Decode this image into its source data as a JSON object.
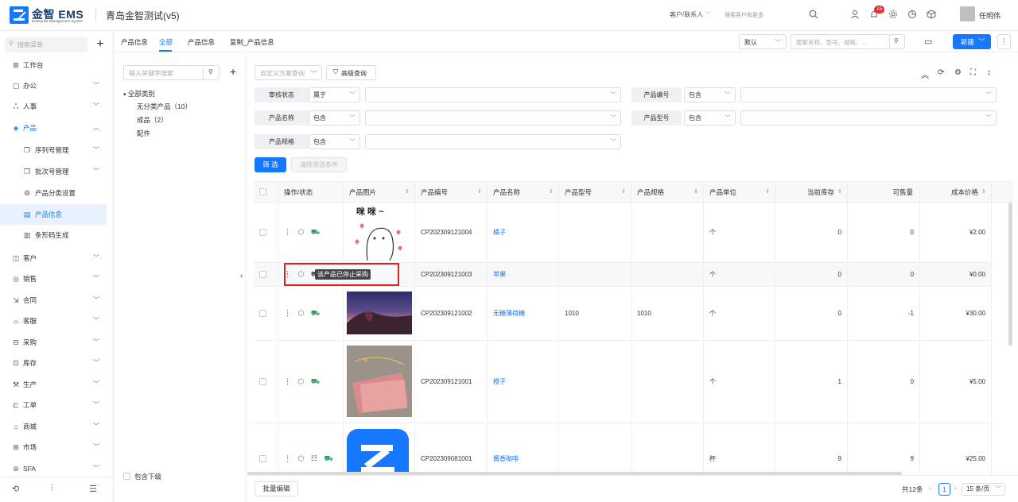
{
  "header": {
    "logo_text": "金智 EMS",
    "logo_sub": "Enterprise Management System",
    "company": "青岛金智测试(v5)",
    "search_type": "客户/联系人",
    "search_placeholder": "搜索客户和更多",
    "notification_count": "15",
    "user_name": "任明伟"
  },
  "sidebar": {
    "search_placeholder": "搜索菜单",
    "items": [
      {
        "label": "工作台",
        "icon": "dashboard-icon"
      },
      {
        "label": "办公",
        "icon": "office-icon"
      },
      {
        "label": "人事",
        "icon": "people-icon"
      },
      {
        "label": "产品",
        "icon": "product-icon"
      },
      {
        "label": "序列号管理",
        "icon": "serial-icon"
      },
      {
        "label": "批次号管理",
        "icon": "batch-icon"
      },
      {
        "label": "产品分类设置",
        "icon": "category-gear-icon"
      },
      {
        "label": "产品信息",
        "icon": "doc-icon"
      },
      {
        "label": "条形码生成",
        "icon": "barcode-icon"
      },
      {
        "label": "客户",
        "icon": "customer-icon"
      },
      {
        "label": "销售",
        "icon": "sales-icon"
      },
      {
        "label": "合同",
        "icon": "contract-icon"
      },
      {
        "label": "客服",
        "icon": "support-icon"
      },
      {
        "label": "采购",
        "icon": "purchase-icon"
      },
      {
        "label": "库存",
        "icon": "stock-icon"
      },
      {
        "label": "生产",
        "icon": "production-icon"
      },
      {
        "label": "工单",
        "icon": "workorder-icon"
      },
      {
        "label": "商城",
        "icon": "mall-icon"
      },
      {
        "label": "市场",
        "icon": "market-icon"
      },
      {
        "label": "SFA",
        "icon": "sfa-icon"
      }
    ]
  },
  "tabs": {
    "section_title": "产品信息",
    "items": [
      "全部",
      "产品信息",
      "复制_产品信息"
    ]
  },
  "toolbar": {
    "view_select": "默认",
    "search_placeholder": "搜索名称、型号、规格、...",
    "new_button": "新建"
  },
  "tree": {
    "search_placeholder": "输入关键字搜索",
    "root": "全部类别",
    "children": [
      "无分类产品（10）",
      "成品（2）",
      "配件"
    ],
    "include_sub": "包含下级"
  },
  "filters": {
    "custom_scheme_placeholder": "自定义方案查询",
    "advanced": "高级查询",
    "rows": [
      {
        "label": "审核状态",
        "op": "属于"
      },
      {
        "label": "产品编号",
        "op": "包含"
      },
      {
        "label": "产品名称",
        "op": "包含"
      },
      {
        "label": "产品型号",
        "op": "包含"
      },
      {
        "label": "产品规格",
        "op": "包含"
      }
    ],
    "filter_button": "筛 选",
    "clear_button": "清除筛选条件"
  },
  "table": {
    "columns": [
      "操作/状态",
      "产品图片",
      "产品编号",
      "产品名称",
      "产品型号",
      "产品规格",
      "产品单位",
      "当前库存",
      "可售量",
      "成本价格"
    ],
    "rows": [
      {
        "code": "CP202309121004",
        "name": "橘子",
        "model": "",
        "spec": "",
        "unit": "个",
        "stock": "0",
        "sellable": "0",
        "cost": "¥2.00"
      },
      {
        "code": "CP202309121003",
        "name": "苹果",
        "model": "",
        "spec": "",
        "unit": "个",
        "stock": "0",
        "sellable": "0",
        "cost": "¥0.00"
      },
      {
        "code": "CP202309121002",
        "name": "无糖薄荷糖",
        "model": "1010",
        "spec": "1010",
        "unit": "个",
        "stock": "0",
        "sellable": "-1",
        "cost": "¥30.00"
      },
      {
        "code": "CP202309121001",
        "name": "橙子",
        "model": "",
        "spec": "",
        "unit": "个",
        "stock": "1",
        "sellable": "0",
        "cost": "¥5.00"
      },
      {
        "code": "CP202309081001",
        "name": "酱香咖啡",
        "model": "",
        "spec": "",
        "unit": "杯",
        "stock": "9",
        "sellable": "9",
        "cost": "¥25.00"
      }
    ],
    "sticker_text": "咪 咪 ~",
    "tooltip": "该产品已停止采购"
  },
  "footer": {
    "batch_edit": "批量编辑",
    "total": "共12条",
    "page": "1",
    "page_size": "15 条/页"
  },
  "colors": {
    "accent": "#1677ff",
    "status_green": "#2c9f5a",
    "highlight_red": "#e02020"
  }
}
